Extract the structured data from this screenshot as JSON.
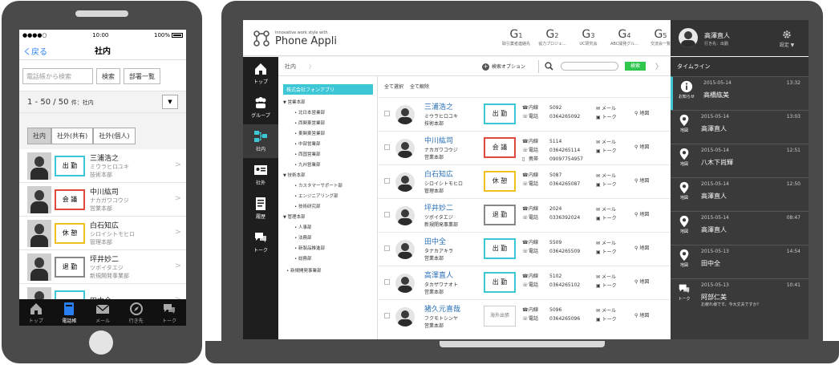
{
  "phone": {
    "status": {
      "carrier": "●●●●○ ",
      "time": "10:00",
      "battery": "100%"
    },
    "nav": {
      "back_label": "く戻る",
      "title": "社内"
    },
    "search": {
      "placeholder": "電話帳から検索",
      "search_label": "検索",
      "dept_label": "部署一覧"
    },
    "count": {
      "range": "1 - 50 / 50",
      "suffix": "件：社内",
      "dropdown": "▼"
    },
    "tabs": [
      {
        "label": "社内",
        "active": true
      },
      {
        "label": "社外(共有)",
        "active": false
      },
      {
        "label": "社外(個人)",
        "active": false
      }
    ],
    "contacts": [
      {
        "name": "三浦浩之",
        "kana": "ミウラヒロユキ",
        "dept": "技術本部",
        "status": "出 勤",
        "status_color": "#3cc6d6"
      },
      {
        "name": "中川紘司",
        "kana": "ナカガワコウジ",
        "dept": "営業本部",
        "status": "会 議",
        "status_color": "#e04a3c"
      },
      {
        "name": "白石知広",
        "kana": "シロイシトモヒロ",
        "dept": "管理本部",
        "status": "休 憩",
        "status_color": "#f0c020"
      },
      {
        "name": "坪井妙二",
        "kana": "ツボイタエジ",
        "dept": "新規開発事業部",
        "status": "退 勤",
        "status_color": "#888888"
      },
      {
        "name": "田中全",
        "kana": "",
        "dept": "",
        "status": "",
        "status_color": "#3cc6d6"
      }
    ],
    "tabbar": [
      {
        "label": "トップ",
        "icon": "home-icon",
        "active": false
      },
      {
        "label": "電話帳",
        "icon": "phonebook-icon",
        "active": true
      },
      {
        "label": "メール",
        "icon": "mail-icon",
        "active": false
      },
      {
        "label": "行き先",
        "icon": "compass-icon",
        "active": false
      },
      {
        "label": "トーク",
        "icon": "chat-icon",
        "active": false
      }
    ]
  },
  "laptop": {
    "logo": {
      "tagline": "innovative work style with",
      "name": "Phone Appli"
    },
    "gnav": [
      {
        "g": "G",
        "n": "1",
        "label": "取引業者連絡先"
      },
      {
        "g": "G",
        "n": "2",
        "label": "協力プロジェ..."
      },
      {
        "g": "G",
        "n": "3",
        "label": "UC研究会"
      },
      {
        "g": "G",
        "n": "4",
        "label": "ABC開発グル..."
      },
      {
        "g": "G",
        "n": "5",
        "label": "交流会一覧"
      }
    ],
    "user": {
      "name": "高澤直人",
      "status": "行き先：出勤",
      "settings_label": "設定 ▼"
    },
    "sidebar": [
      {
        "label": "トップ",
        "icon": "home-icon",
        "active": false
      },
      {
        "label": "グループ",
        "icon": "group-icon",
        "active": false
      },
      {
        "label": "社内",
        "icon": "org-icon",
        "active": true
      },
      {
        "label": "社外",
        "icon": "card-icon",
        "active": false
      },
      {
        "label": "履歴",
        "icon": "history-icon",
        "active": false
      },
      {
        "label": "トーク",
        "icon": "chat-icon",
        "active": false
      }
    ],
    "toolbar": {
      "breadcrumb": "社内",
      "options_label": "検索オプション",
      "search_label": "検索"
    },
    "tree": {
      "root": "株式会社フォンアプリ",
      "nodes": [
        {
          "label": "営業本部",
          "level": "l1"
        },
        {
          "label": "北日本営業部",
          "level": "l2"
        },
        {
          "label": "西関東営業部",
          "level": "l2"
        },
        {
          "label": "東関東営業部",
          "level": "l2"
        },
        {
          "label": "中部営業部",
          "level": "l2"
        },
        {
          "label": "西国営業部",
          "level": "l2"
        },
        {
          "label": "九州営業部",
          "level": "l2"
        },
        {
          "label": "技術本部",
          "level": "l1"
        },
        {
          "label": "カスタマーサポート部",
          "level": "l2"
        },
        {
          "label": "エンジニアリング部",
          "level": "l2"
        },
        {
          "label": "技術研究部",
          "level": "l2"
        },
        {
          "label": "管理本部",
          "level": "l1"
        },
        {
          "label": "人事部",
          "level": "l2"
        },
        {
          "label": "法務部",
          "level": "l2"
        },
        {
          "label": "新製品推進部",
          "level": "l2"
        },
        {
          "label": "総務部",
          "level": "l2"
        },
        {
          "label": "新規開発事業部",
          "level": "l1b"
        }
      ]
    },
    "list": {
      "select_all": "全て選択",
      "deselect_all": "全て解除",
      "labels": {
        "ext": "内線",
        "tel": "電話",
        "mobile": "携帯",
        "mail": "メール",
        "talk": "トーク",
        "map": "地図"
      },
      "rows": [
        {
          "name": "三浦浩之",
          "kana": "ミウラヒロユキ",
          "dept": "技術本部",
          "status": "出 勤",
          "status_color": "#3cc6d6",
          "ext": "5092",
          "tel": "0364265092",
          "mobile": ""
        },
        {
          "name": "中川紘司",
          "kana": "ナカガワコウジ",
          "dept": "営業本部",
          "status": "会 議",
          "status_color": "#e04a3c",
          "ext": "5114",
          "tel": "0364265114",
          "mobile": "09097754957"
        },
        {
          "name": "白石知広",
          "kana": "シロイシトモヒロ",
          "dept": "管理本部",
          "status": "休 憩",
          "status_color": "#f0c020",
          "ext": "5087",
          "tel": "0364265087",
          "mobile": ""
        },
        {
          "name": "坪井妙二",
          "kana": "ツボイタエジ",
          "dept": "新規開発事業部",
          "status": "退 勤",
          "status_color": "#888888",
          "ext": "2024",
          "tel": "0336392024",
          "mobile": ""
        },
        {
          "name": "田中全",
          "kana": "タナカアキラ",
          "dept": "営業本部",
          "status": "出 勤",
          "status_color": "#3cc6d6",
          "ext": "5509",
          "tel": "0364265509",
          "mobile": ""
        },
        {
          "name": "高澤直人",
          "kana": "タカザワナオト",
          "dept": "営業本部",
          "status": "出 勤",
          "status_color": "#3cc6d6",
          "ext": "5102",
          "tel": "0364265102",
          "mobile": ""
        },
        {
          "name": "猪久元喜哉",
          "kana": "フクモトシンヤ",
          "dept": "営業本部",
          "status": "海外出張",
          "status_color": "#cccccc",
          "ext": "5096",
          "tel": "0364265096",
          "mobile": ""
        }
      ]
    },
    "timeline": {
      "title": "タイムライン",
      "items": [
        {
          "date": "2015-05-14",
          "time": "13:32",
          "name": "高橋紘美",
          "icon": "info-icon",
          "label": "お知らせ",
          "msg": ""
        },
        {
          "date": "2015-05-14",
          "time": "13:03",
          "name": "高澤直人",
          "icon": "pin-icon",
          "label": "地図",
          "msg": ""
        },
        {
          "date": "2015-05-14",
          "time": "12:51",
          "name": "八木下尚輝",
          "icon": "pin-icon",
          "label": "地図",
          "msg": ""
        },
        {
          "date": "2015-05-14",
          "time": "12:50",
          "name": "高澤直人",
          "icon": "pin-icon",
          "label": "地図",
          "msg": ""
        },
        {
          "date": "2015-05-14",
          "time": "08:47",
          "name": "高澤直人",
          "icon": "pin-icon",
          "label": "地図",
          "msg": ""
        },
        {
          "date": "2015-05-13",
          "time": "14:54",
          "name": "田中全",
          "icon": "pin-icon",
          "label": "地図",
          "msg": ""
        },
        {
          "date": "2015-05-13",
          "time": "10:41",
          "name": "阿部仁美",
          "icon": "chat-icon",
          "label": "トーク",
          "msg": "お疲れ様です。今大丈夫ですか？"
        }
      ]
    }
  }
}
